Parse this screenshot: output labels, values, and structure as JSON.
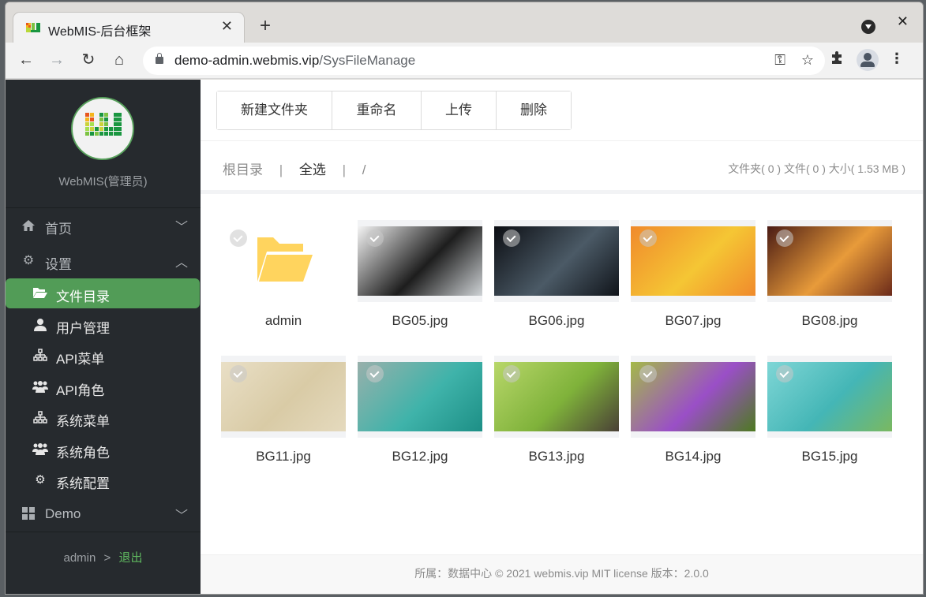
{
  "browser": {
    "tab_title": "WebMIS-后台框架",
    "url_host": "demo-admin.webmis.vip",
    "url_path": "/SysFileManage",
    "icons": [
      "back-icon",
      "forward-icon",
      "reload-icon",
      "home-icon",
      "lock-icon",
      "key-icon",
      "star-icon",
      "extensions-icon",
      "profile-icon",
      "menu-icon"
    ]
  },
  "sidebar": {
    "brand": "WebMIS(管理员)",
    "menus": [
      {
        "label": "首页",
        "icon": "home-icon",
        "expanded": false
      },
      {
        "label": "设置",
        "icon": "gear-icon",
        "expanded": true
      },
      {
        "label": "Demo",
        "icon": "grid-icon",
        "expanded": false
      }
    ],
    "sub_items": [
      {
        "label": "文件目录",
        "icon": "folder-open-icon",
        "active": true
      },
      {
        "label": "用户管理",
        "icon": "user-icon",
        "active": false
      },
      {
        "label": "API菜单",
        "icon": "sitemap-icon",
        "active": false
      },
      {
        "label": "API角色",
        "icon": "users-icon",
        "active": false
      },
      {
        "label": "系统菜单",
        "icon": "sitemap-icon",
        "active": false
      },
      {
        "label": "系统角色",
        "icon": "users-icon",
        "active": false
      },
      {
        "label": "系统配置",
        "icon": "cogs-icon",
        "active": false
      }
    ],
    "user": "admin",
    "user_sep": ">",
    "logout": "退出"
  },
  "toolbar": {
    "buttons": [
      "新建文件夹",
      "重命名",
      "上传",
      "删除"
    ]
  },
  "path_bar": {
    "root": "根目录",
    "select_all": "全选",
    "separator": "|",
    "current_path": "/",
    "stats": "文件夹( 0 ) 文件( 0 ) 大小( 1.53 MB )"
  },
  "files": [
    {
      "name": "admin",
      "type": "folder"
    },
    {
      "name": "BG05.jpg",
      "type": "image",
      "colors": [
        "#f4f4f4",
        "#1d1d1d",
        "#cfd3d6"
      ]
    },
    {
      "name": "BG06.jpg",
      "type": "image",
      "colors": [
        "#0b0d12",
        "#4b5a66",
        "#10141a"
      ]
    },
    {
      "name": "BG07.jpg",
      "type": "image",
      "colors": [
        "#f08a2c",
        "#f5c634",
        "#f08a2c"
      ]
    },
    {
      "name": "BG08.jpg",
      "type": "image",
      "colors": [
        "#4a1b14",
        "#e89b3a",
        "#6b2a1a"
      ]
    },
    {
      "name": "BG11.jpg",
      "type": "image",
      "colors": [
        "#e9dfc6",
        "#d9cba6",
        "#e5dabe"
      ]
    },
    {
      "name": "BG12.jpg",
      "type": "image",
      "colors": [
        "#98b0ab",
        "#3fb3aa",
        "#1d8f86"
      ]
    },
    {
      "name": "BG13.jpg",
      "type": "image",
      "colors": [
        "#b8d76a",
        "#7fb23a",
        "#4a4036"
      ]
    },
    {
      "name": "BG14.jpg",
      "type": "image",
      "colors": [
        "#a4b948",
        "#9a4fc7",
        "#4d7a20"
      ]
    },
    {
      "name": "BG15.jpg",
      "type": "image",
      "colors": [
        "#7fd6d6",
        "#44b6b6",
        "#7ab860"
      ]
    }
  ],
  "footer": "所属：数据中心  © 2021 webmis.vip MIT license  版本：2.0.0",
  "colors": {
    "accent": "#529c57",
    "sidebar_bg": "#262a2e",
    "folder": "#ffd45e"
  }
}
